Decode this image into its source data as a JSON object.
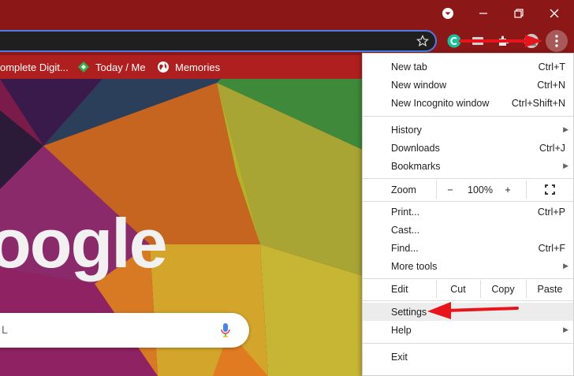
{
  "bookmarks": [
    {
      "label": "omplete Digit..."
    },
    {
      "label": "Today / Me"
    },
    {
      "label": "Memories"
    }
  ],
  "search": {
    "letter": "L"
  },
  "logo_text": "oogle",
  "menu": {
    "new_tab": {
      "label": "New tab",
      "shortcut": "Ctrl+T"
    },
    "new_window": {
      "label": "New window",
      "shortcut": "Ctrl+N"
    },
    "incognito": {
      "label": "New Incognito window",
      "shortcut": "Ctrl+Shift+N"
    },
    "history": {
      "label": "History"
    },
    "downloads": {
      "label": "Downloads",
      "shortcut": "Ctrl+J"
    },
    "bookmarks": {
      "label": "Bookmarks"
    },
    "zoom": {
      "label": "Zoom",
      "minus": "−",
      "value": "100%",
      "plus": "+"
    },
    "print": {
      "label": "Print...",
      "shortcut": "Ctrl+P"
    },
    "cast": {
      "label": "Cast..."
    },
    "find": {
      "label": "Find...",
      "shortcut": "Ctrl+F"
    },
    "more_tools": {
      "label": "More tools"
    },
    "edit": {
      "label": "Edit",
      "cut": "Cut",
      "copy": "Copy",
      "paste": "Paste"
    },
    "settings": {
      "label": "Settings"
    },
    "help": {
      "label": "Help"
    },
    "exit": {
      "label": "Exit"
    }
  },
  "colors": {
    "accent_arrow": "#e8141b",
    "titlebar": "#8b1717",
    "bookmarks_bar": "#b01f1f"
  },
  "icons": [
    "profile-icon",
    "minimize-icon",
    "restore-icon",
    "close-icon",
    "star-icon",
    "grammarly-icon",
    "extension-icon",
    "puzzle-icon",
    "avatar-icon",
    "more-vert-icon",
    "fullscreen-icon",
    "mic-icon"
  ]
}
